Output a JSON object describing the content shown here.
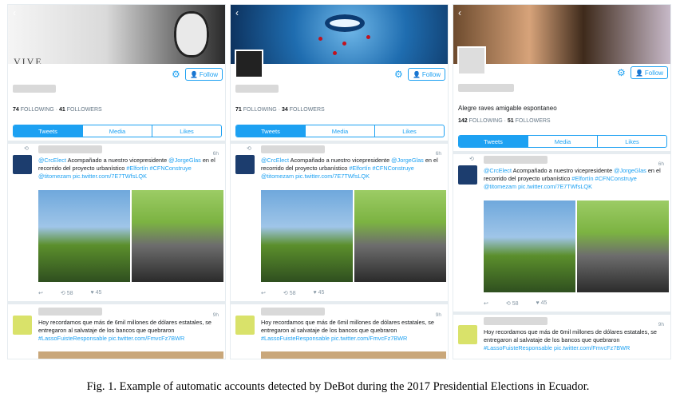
{
  "panels": [
    {
      "back": "‹",
      "banner_text": "VIVE",
      "follow_label": "Follow",
      "bio": "",
      "stats": {
        "following": "74",
        "following_label": "FOLLOWING",
        "followers": "41",
        "followers_label": "FOLLOWERS"
      },
      "tabs": [
        "Tweets",
        "Media",
        "Likes"
      ],
      "tweet1": {
        "time": "6h",
        "text_1": "@CrcElect",
        "text_2": " Acompañado a nuestro vicepresidente ",
        "text_3": "@JorgeGlas",
        "text_4": " en el recorrido del proyecto urbanístico ",
        "text_5": "#Elfortín #CFNConstruye",
        "text_6": " ",
        "text_7": "@titomezam pic.twitter.com/7E7TWfsLQK",
        "retweets": "58",
        "likes": "45"
      },
      "tweet2": {
        "time": "9h",
        "text_1": "Hoy recordamos que más de 6mil millones de dólares estatales, se entregaron al salvataje de los bancos que quebraron",
        "text_2": "#LassoFuisteResponsable pic.twitter.com/FmvcFz7BWR"
      }
    },
    {
      "back": "‹",
      "follow_label": "Follow",
      "bio": "",
      "stats": {
        "following": "71",
        "following_label": "FOLLOWING",
        "followers": "34",
        "followers_label": "FOLLOWERS"
      },
      "tabs": [
        "Tweets",
        "Media",
        "Likes"
      ],
      "tweet1": {
        "time": "6h",
        "text_1": "@CrcElect",
        "text_2": " Acompañado a nuestro vicepresidente ",
        "text_3": "@JorgeGlas",
        "text_4": " en el recorrido del proyecto urbanístico ",
        "text_5": "#Elfortín #CFNConstruye",
        "text_6": " ",
        "text_7": "@titomezam pic.twitter.com/7E7TWfsLQK",
        "retweets": "58",
        "likes": "45"
      },
      "tweet2": {
        "time": "9h",
        "text_1": "Hoy recordamos que más de 6mil millones de dólares estatales, se entregaron al salvataje de los bancos que quebraron",
        "text_2": "#LassoFuisteResponsable pic.twitter.com/FmvcFz7BWR"
      }
    },
    {
      "back": "‹",
      "follow_label": "Follow",
      "bio": "Alegre raves amigable espontaneo",
      "stats": {
        "following": "142",
        "following_label": "FOLLOWING",
        "followers": "51",
        "followers_label": "FOLLOWERS"
      },
      "tabs": [
        "Tweets",
        "Media",
        "Likes"
      ],
      "tweet1": {
        "time": "6h",
        "text_1": "@CrcElect",
        "text_2": " Acompañado a nuestro vicepresidente ",
        "text_3": "@JorgeGlas",
        "text_4": " en el recorrido del proyecto urbanístico ",
        "text_5": "#Elfortín #CFNConstruye",
        "text_6": " ",
        "text_7": "@titomezam pic.twitter.com/7E7TWfsLQK",
        "retweets": "58",
        "likes": "45"
      },
      "tweet2": {
        "time": "9h",
        "text_1": "Hoy recordamos que más de 6mil millones de dólares estatales, se entregaron al salvataje de los bancos que quebraron",
        "text_2": "#LassoFuisteResponsable pic.twitter.com/FmvcFz7BWR"
      }
    }
  ],
  "icons": {
    "gear": "gear-icon",
    "follow": "add-user-icon",
    "reply": "reply-icon",
    "retweet": "retweet-icon",
    "like": "heart-icon"
  },
  "colors": {
    "accent": "#1da1f2",
    "muted": "#657786"
  },
  "caption": "Fig. 1.  Example of automatic accounts detected by DeBot during the 2017 Presidential Elections in Ecuador."
}
